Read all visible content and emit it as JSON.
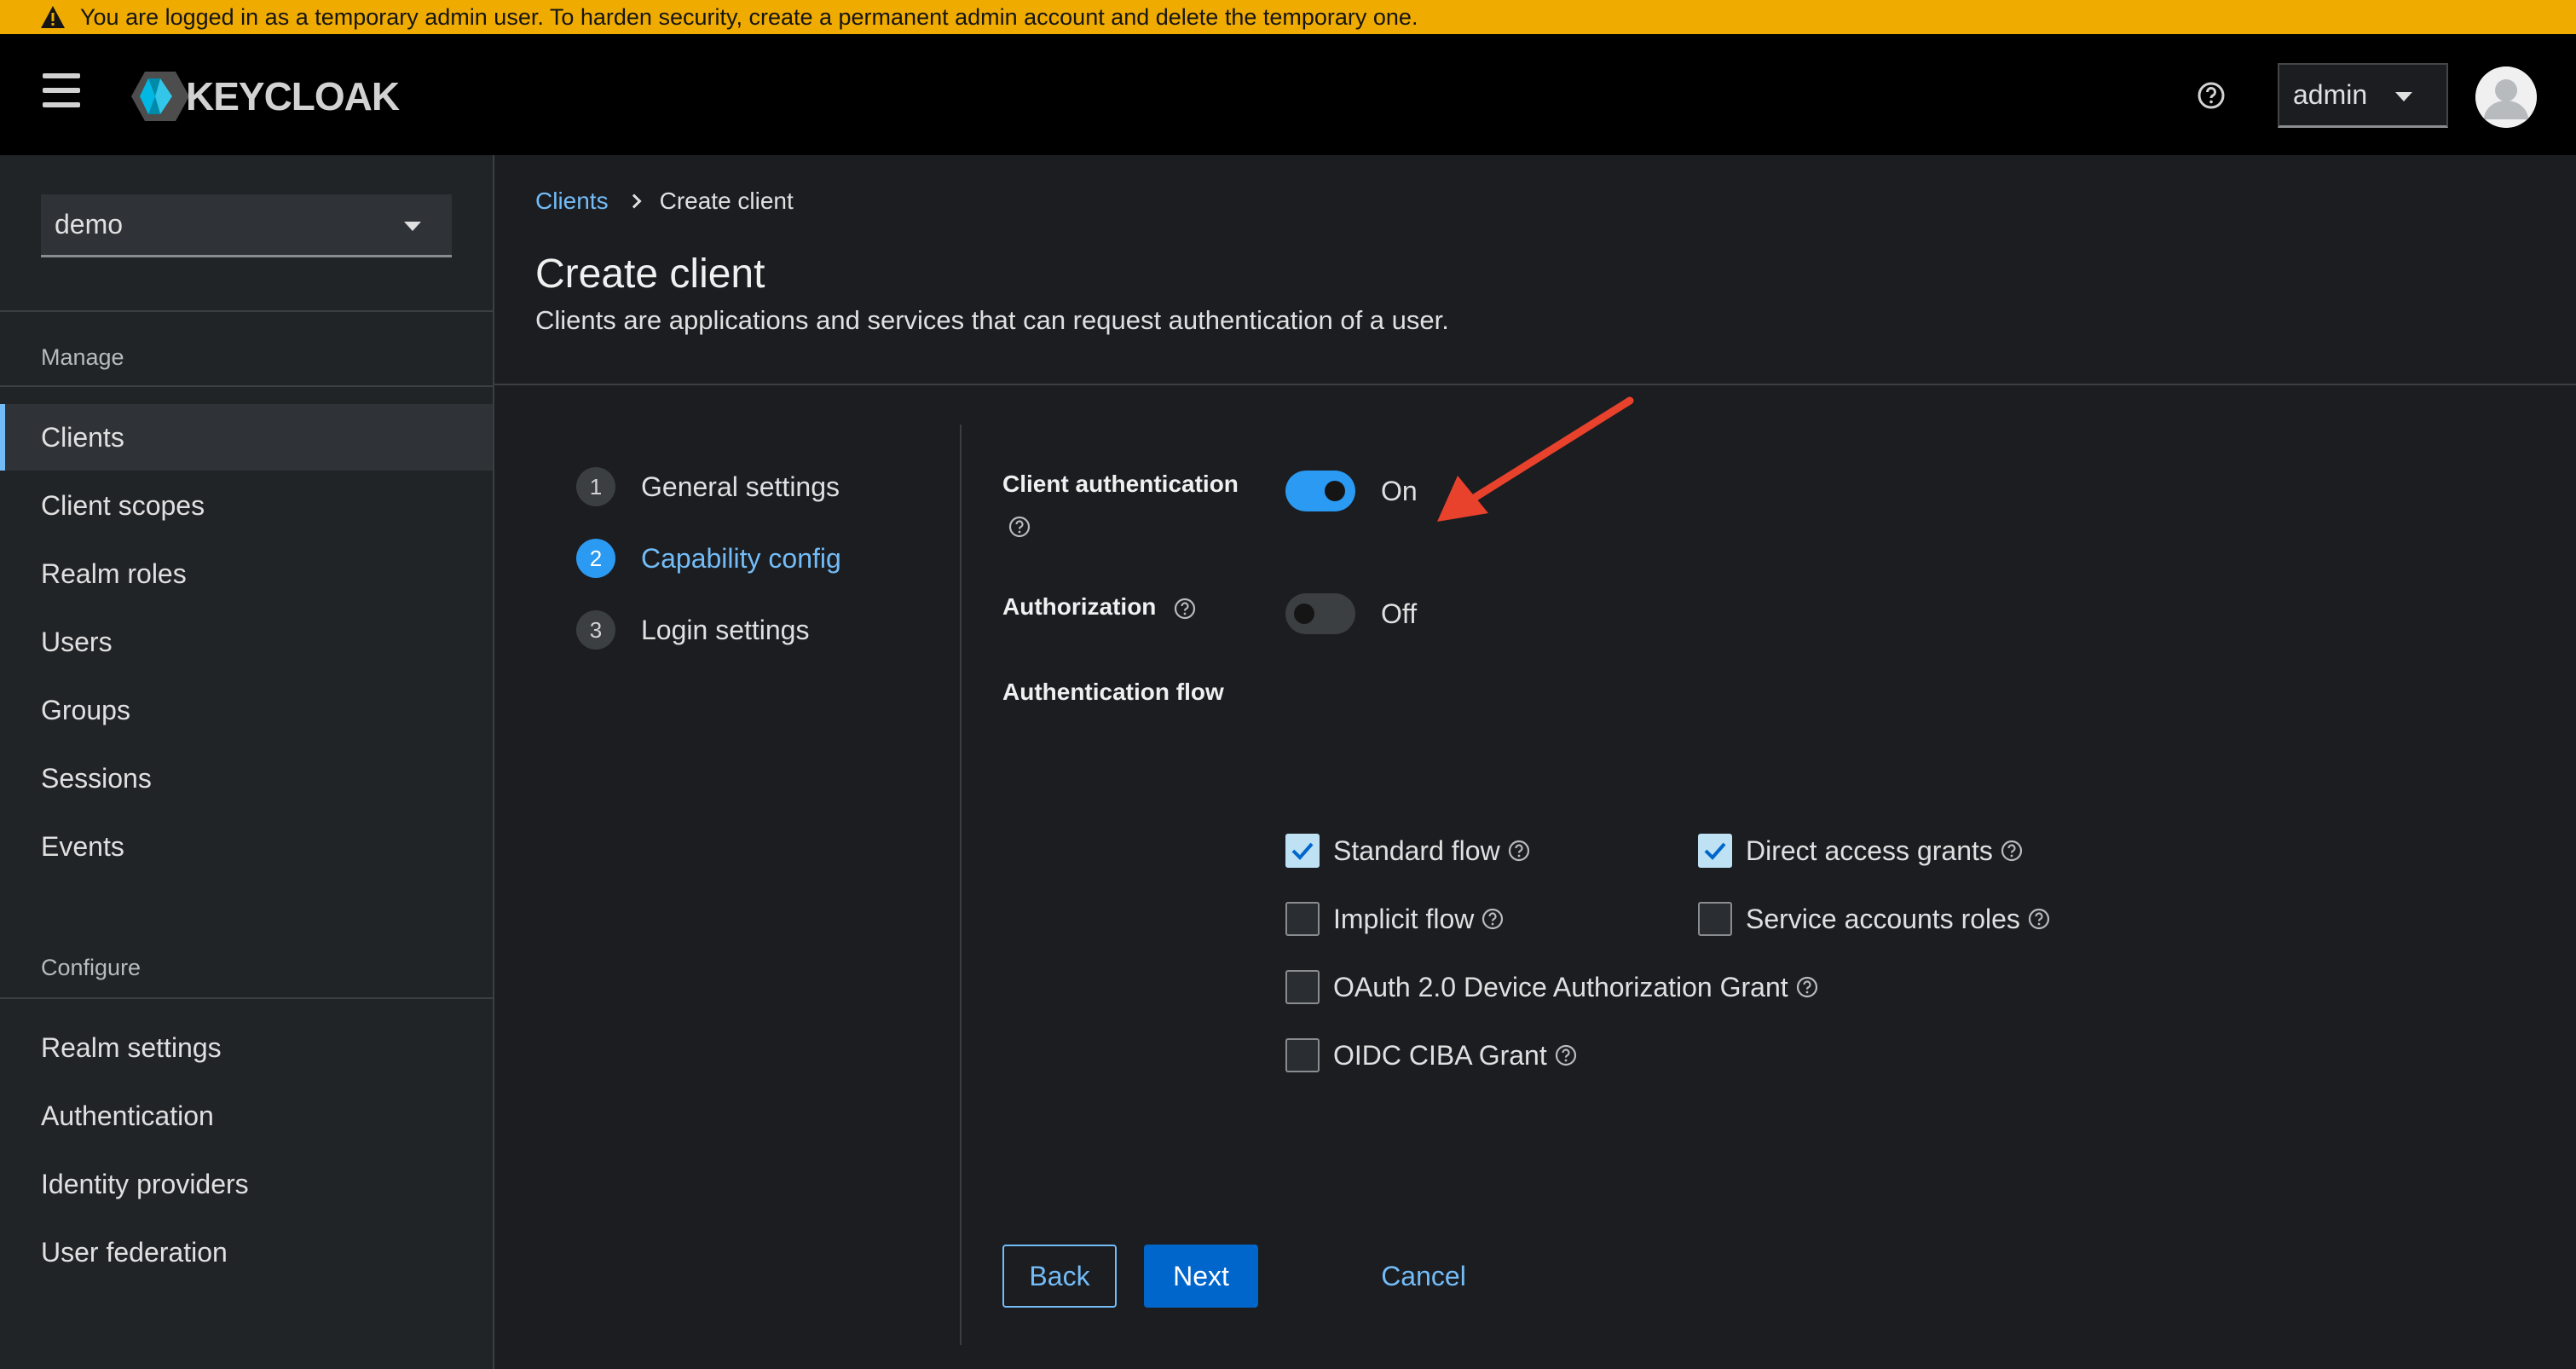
{
  "banner": {
    "message": "You are logged in as a temporary admin user. To harden security, create a permanent admin account and delete the temporary one."
  },
  "header": {
    "logo_text": "KEYCLOAK",
    "user_name": "admin"
  },
  "sidebar": {
    "realm": "demo",
    "manage_title": "Manage",
    "manage_items": [
      {
        "label": "Clients",
        "active": true
      },
      {
        "label": "Client scopes"
      },
      {
        "label": "Realm roles"
      },
      {
        "label": "Users"
      },
      {
        "label": "Groups"
      },
      {
        "label": "Sessions"
      },
      {
        "label": "Events"
      }
    ],
    "configure_title": "Configure",
    "configure_items": [
      {
        "label": "Realm settings"
      },
      {
        "label": "Authentication"
      },
      {
        "label": "Identity providers"
      },
      {
        "label": "User federation"
      }
    ]
  },
  "breadcrumb": {
    "parent": "Clients",
    "current": "Create client"
  },
  "page": {
    "title": "Create client",
    "description": "Clients are applications and services that can request authentication of a user."
  },
  "wizard": {
    "steps": [
      {
        "number": "1",
        "label": "General settings"
      },
      {
        "number": "2",
        "label": "Capability config",
        "current": true
      },
      {
        "number": "3",
        "label": "Login settings"
      }
    ]
  },
  "form": {
    "client_auth_label": "Client authentication",
    "client_auth_state": "On",
    "authorization_label": "Authorization",
    "authorization_state": "Off",
    "auth_flow_label": "Authentication flow",
    "flows": {
      "standard": {
        "label": "Standard flow",
        "checked": true
      },
      "direct": {
        "label": "Direct access grants",
        "checked": true
      },
      "implicit": {
        "label": "Implicit flow",
        "checked": false
      },
      "service": {
        "label": "Service accounts roles",
        "checked": false
      },
      "device": {
        "label": "OAuth 2.0 Device Authorization Grant",
        "checked": false
      },
      "ciba": {
        "label": "OIDC CIBA Grant",
        "checked": false
      }
    }
  },
  "buttons": {
    "back": "Back",
    "next": "Next",
    "cancel": "Cancel"
  },
  "colors": {
    "banner": "#f0ab00",
    "accent": "#73bcf7",
    "primary": "#0066cc",
    "annotation": "#e8412c"
  }
}
